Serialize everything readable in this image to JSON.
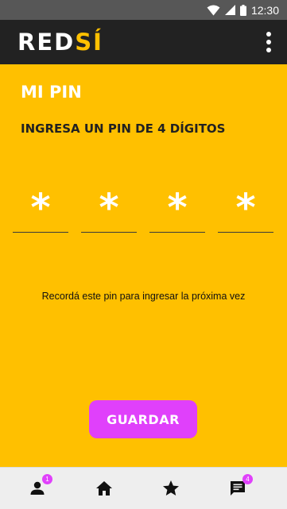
{
  "status_bar": {
    "time": "12:30"
  },
  "app_bar": {
    "logo_part1": "RED",
    "logo_part2": "SÍ",
    "menu_icon": "more-vert-icon"
  },
  "page": {
    "title": "MI PIN",
    "subtitle": "INGRESA UN PIN DE 4 DÍGITOS",
    "pin_digits": [
      "*",
      "*",
      "*",
      "*"
    ],
    "hint": "Recordá este pin para ingresar la próxima vez",
    "save_label": "GUARDAR"
  },
  "bottom_nav": {
    "items": [
      {
        "icon": "person-icon",
        "badge": "1"
      },
      {
        "icon": "home-icon"
      },
      {
        "icon": "star-icon"
      },
      {
        "icon": "chat-icon",
        "badge": "4"
      }
    ]
  },
  "colors": {
    "background": "#ffc000",
    "app_bar": "#222222",
    "accent": "#e040fb",
    "status_bar": "#575757"
  }
}
